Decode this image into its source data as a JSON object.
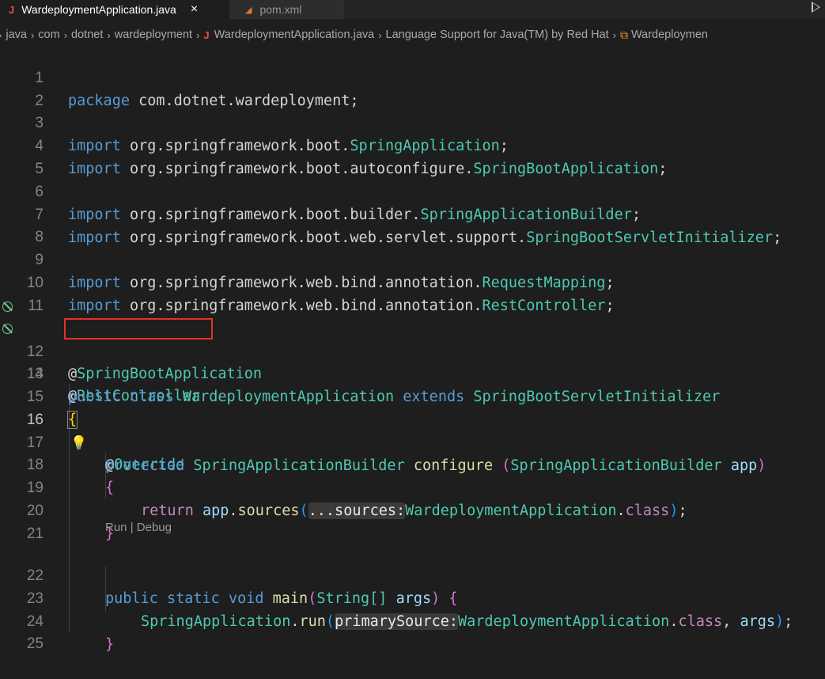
{
  "tabs": [
    {
      "label": "WardeploymentApplication.java",
      "active": true,
      "icon": "java-file-icon"
    },
    {
      "label": "pom.xml",
      "active": false,
      "icon": "rss-xml-icon"
    }
  ],
  "breadcrumb": {
    "items": [
      "java",
      "com",
      "dotnet",
      "wardeployment",
      "WardeploymentApplication.java",
      "Language Support for Java(TM) by Red Hat",
      "Wardeploymen"
    ]
  },
  "codelens": {
    "run": "Run",
    "sep": "|",
    "debug": "Debug"
  },
  "line_numbers": [
    "1",
    "2",
    "3",
    "4",
    "5",
    "6",
    "7",
    "8",
    "9",
    "10",
    "11",
    "12",
    "13",
    "14",
    "15",
    "16",
    "17",
    "18",
    "19",
    "20",
    "21",
    "22",
    "23",
    "24",
    "25"
  ],
  "code": {
    "l1": {
      "kw": "package",
      "pkg": "com.dotnet.wardeployment;"
    },
    "l3": {
      "kw": "import",
      "path": "org.springframework.boot.",
      "cls": "SpringApplication",
      "end": ";"
    },
    "l4": {
      "kw": "import",
      "path": "org.springframework.boot.autoconfigure.",
      "cls": "SpringBootApplication",
      "end": ";"
    },
    "l6": {
      "kw": "import",
      "path": "org.springframework.boot.builder.",
      "cls": "SpringApplicationBuilder",
      "end": ";"
    },
    "l7": {
      "kw": "import",
      "path": "org.springframework.boot.web.servlet.support.",
      "cls": "SpringBootServletInitializer",
      "end": ";"
    },
    "l9": {
      "kw": "import",
      "path": "org.springframework.web.bind.annotation.",
      "cls": "RequestMapping",
      "end": ";"
    },
    "l10": {
      "kw": "import",
      "path": "org.springframework.web.bind.annotation.",
      "cls": "RestController",
      "end": ";"
    },
    "l12": {
      "at": "@",
      "name": "SpringBootApplication"
    },
    "l13": {
      "at": "@",
      "name": "RestController"
    },
    "l14": {
      "kw1": "public",
      "kw2": "class",
      "cls": "WardeploymentApplication",
      "kw3": "extends",
      "parent": "SpringBootServletInitializer"
    },
    "l15": {
      "brace": "{"
    },
    "l16": {
      "at": "@",
      "name": "Override"
    },
    "l17": {
      "kw": "protected",
      "ret": "SpringApplicationBuilder",
      "fn": "configure",
      "sp": " ",
      "po": "(",
      "ptype": "SpringApplicationBuilder",
      "pname": "app",
      "pc": ")"
    },
    "l18": {
      "brace": "{"
    },
    "l19": {
      "kw": "return",
      "obj": "app",
      "dot": ".",
      "fn": "sources",
      "po": "(",
      "hint": "...sources:",
      "cls": "WardeploymentApplication",
      "dot2": ".",
      "cl": "class",
      "pc": ")",
      "end": ";"
    },
    "l20": {
      "brace": "}"
    },
    "l22": {
      "kw1": "public",
      "kw2": "static",
      "kw3": "void",
      "fn": "main",
      "po": "(",
      "ptype": "String[]",
      "pname": "args",
      "pc": ")",
      "brace": "{"
    },
    "l23": {
      "cls": "SpringApplication",
      "dot": ".",
      "fn": "run",
      "po": "(",
      "hint": "primarySource:",
      "arg": "WardeploymentApplication",
      "dot2": ".",
      "cl": "class",
      "comma": ", ",
      "args": "args",
      "pc": ")",
      "end": ";"
    },
    "l24": {
      "brace": "}"
    }
  },
  "colors": {
    "highlight_box": "#e5302a",
    "background": "#1e1e1e"
  }
}
